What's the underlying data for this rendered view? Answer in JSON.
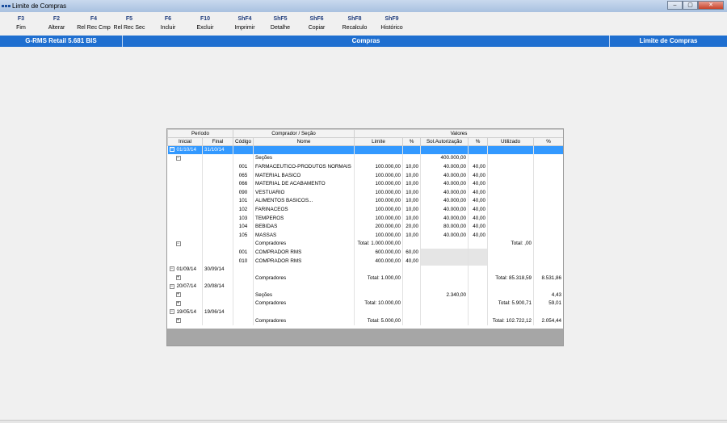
{
  "window": {
    "title": "Limite de Compras",
    "controls": [
      "–",
      "▢",
      "✕"
    ]
  },
  "toolbar": [
    {
      "key": "F3",
      "label": "Fim"
    },
    {
      "key": "F2",
      "label": "Alterar"
    },
    {
      "key": "F4",
      "label": "Rel Rec Cmp"
    },
    {
      "key": "F5",
      "label": "Rel Rec Sec"
    },
    {
      "key": "F6",
      "label": "Incluir"
    },
    {
      "key": "F10",
      "label": "Excluir"
    },
    {
      "key": "ShF4",
      "label": "Imprimir"
    },
    {
      "key": "ShF5",
      "label": "Detalhe"
    },
    {
      "key": "ShF6",
      "label": "Copiar"
    },
    {
      "key": "ShF8",
      "label": "Recalculo"
    },
    {
      "key": "ShF9",
      "label": "Histórico"
    }
  ],
  "header": {
    "left": "G-RMS Retail 5.681 BIS",
    "center": "Compras",
    "right": "Limite de Compras"
  },
  "grid": {
    "group_headers": {
      "periodo": "Período",
      "comprador": "Comprador / Seção",
      "valores": "Valores"
    },
    "columns": [
      "Inicial",
      "Final",
      "Código",
      "Nome",
      "Limite",
      "%",
      "Sol.Autorização",
      "%",
      "Utilizado",
      "%"
    ],
    "rows": [
      {
        "type": "period",
        "expand": "−",
        "inicial": "01/10/14",
        "final": "31/10/14",
        "selected": true
      },
      {
        "type": "group",
        "expand": "−",
        "nome": "Seções",
        "sol": "400.000,00"
      },
      {
        "type": "item",
        "cod": "001",
        "nome": "FARMACEUTICO-PRODUTOS NORMAIS",
        "limite": "100.000,00",
        "p1": "10,00",
        "sol": "40.000,00",
        "p2": "40,00"
      },
      {
        "type": "item",
        "cod": "065",
        "nome": "MATERIAL BASICO",
        "limite": "100.000,00",
        "p1": "10,00",
        "sol": "40.000,00",
        "p2": "40,00"
      },
      {
        "type": "item",
        "cod": "066",
        "nome": "MATERIAL DE ACABAMENTO",
        "limite": "100.000,00",
        "p1": "10,00",
        "sol": "40.000,00",
        "p2": "40,00"
      },
      {
        "type": "item",
        "cod": "090",
        "nome": "VESTUARIO",
        "limite": "100.000,00",
        "p1": "10,00",
        "sol": "40.000,00",
        "p2": "40,00"
      },
      {
        "type": "item",
        "cod": "101",
        "nome": "ALIMENTOS BASICOS...",
        "limite": "100.000,00",
        "p1": "10,00",
        "sol": "40.000,00",
        "p2": "40,00"
      },
      {
        "type": "item",
        "cod": "102",
        "nome": "FARINACEOS",
        "limite": "100.000,00",
        "p1": "10,00",
        "sol": "40.000,00",
        "p2": "40,00"
      },
      {
        "type": "item",
        "cod": "103",
        "nome": "TEMPEROS",
        "limite": "100.000,00",
        "p1": "10,00",
        "sol": "40.000,00",
        "p2": "40,00"
      },
      {
        "type": "item",
        "cod": "104",
        "nome": "BEBIDAS",
        "limite": "200.000,00",
        "p1": "20,00",
        "sol": "80.000,00",
        "p2": "40,00"
      },
      {
        "type": "item",
        "cod": "105",
        "nome": "MASSAS",
        "limite": "100.000,00",
        "p1": "10,00",
        "sol": "40.000,00",
        "p2": "40,00"
      },
      {
        "type": "group",
        "expand": "−",
        "nome": "Compradores",
        "limite": "Total: 1.000.000,00",
        "util": "Total: ,00"
      },
      {
        "type": "item",
        "cod": "001",
        "nome": "COMPRADOR RMS",
        "limite": "600.000,00",
        "p1": "60,00",
        "graySol": true
      },
      {
        "type": "item",
        "cod": "010",
        "nome": "COMPRADOR RMS",
        "limite": "400.000,00",
        "p1": "40,00",
        "graySol": true
      },
      {
        "type": "period",
        "expand": "−",
        "inicial": "01/09/14",
        "final": "30/09/14"
      },
      {
        "type": "group",
        "expand": "+",
        "nome": "Compradores",
        "limite": "Total: 1.000,00",
        "util": "Total: 85.318,59",
        "p3": "8.531,86"
      },
      {
        "type": "period",
        "expand": "−",
        "inicial": "20/07/14",
        "final": "20/08/14"
      },
      {
        "type": "group",
        "expand": "+",
        "nome": "Seções",
        "sol": "2.340,00",
        "p3": "4,43"
      },
      {
        "type": "group",
        "expand": "+",
        "nome": "Compradores",
        "limite": "Total: 10.000,00",
        "util": "Total: 5.900,71",
        "p3": "59,01"
      },
      {
        "type": "period",
        "expand": "−",
        "inicial": "19/05/14",
        "final": "19/06/14"
      },
      {
        "type": "group",
        "expand": "+",
        "nome": "Compradores",
        "limite": "Total: 5.000,00",
        "util": "Total: 102.722,12",
        "p3": "2.054,44"
      }
    ]
  }
}
